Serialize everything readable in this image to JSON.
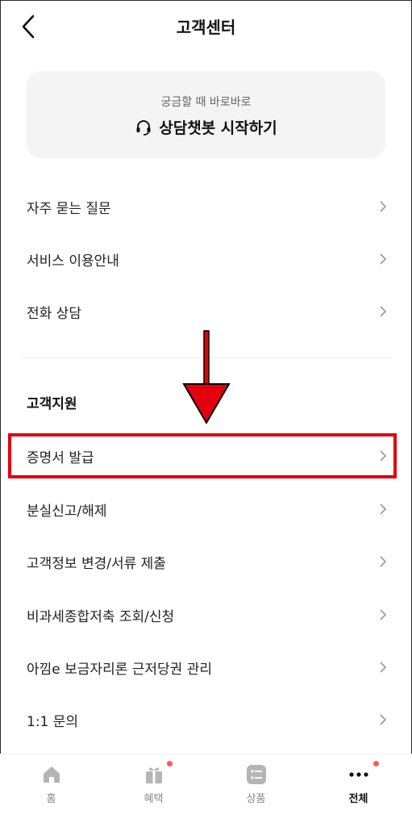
{
  "header": {
    "title": "고객센터"
  },
  "chatbot": {
    "subtitle": "궁금할 때 바로바로",
    "label": "상담챗봇 시작하기"
  },
  "menu_top": [
    {
      "label": "자주 묻는 질문"
    },
    {
      "label": "서비스 이용안내"
    },
    {
      "label": "전화 상담"
    }
  ],
  "section": {
    "title": "고객지원"
  },
  "menu_support": [
    {
      "label": "증명서 발급"
    },
    {
      "label": "분실신고/해제"
    },
    {
      "label": "고객정보 변경/서류 제출"
    },
    {
      "label": "비과세종합저축 조회/신청"
    },
    {
      "label": "아낌e 보금자리론 근저당권 관리"
    },
    {
      "label": "1:1 문의"
    }
  ],
  "tabbar": {
    "tabs": [
      {
        "label": "홈",
        "icon": "home-icon"
      },
      {
        "label": "혜택",
        "icon": "gift-icon"
      },
      {
        "label": "상품",
        "icon": "list-icon"
      },
      {
        "label": "전체",
        "icon": "more-icon"
      }
    ]
  },
  "colors": {
    "highlight": "#e3000f",
    "badge": "#ff5a5a",
    "card_bg": "#f4f4f4"
  }
}
